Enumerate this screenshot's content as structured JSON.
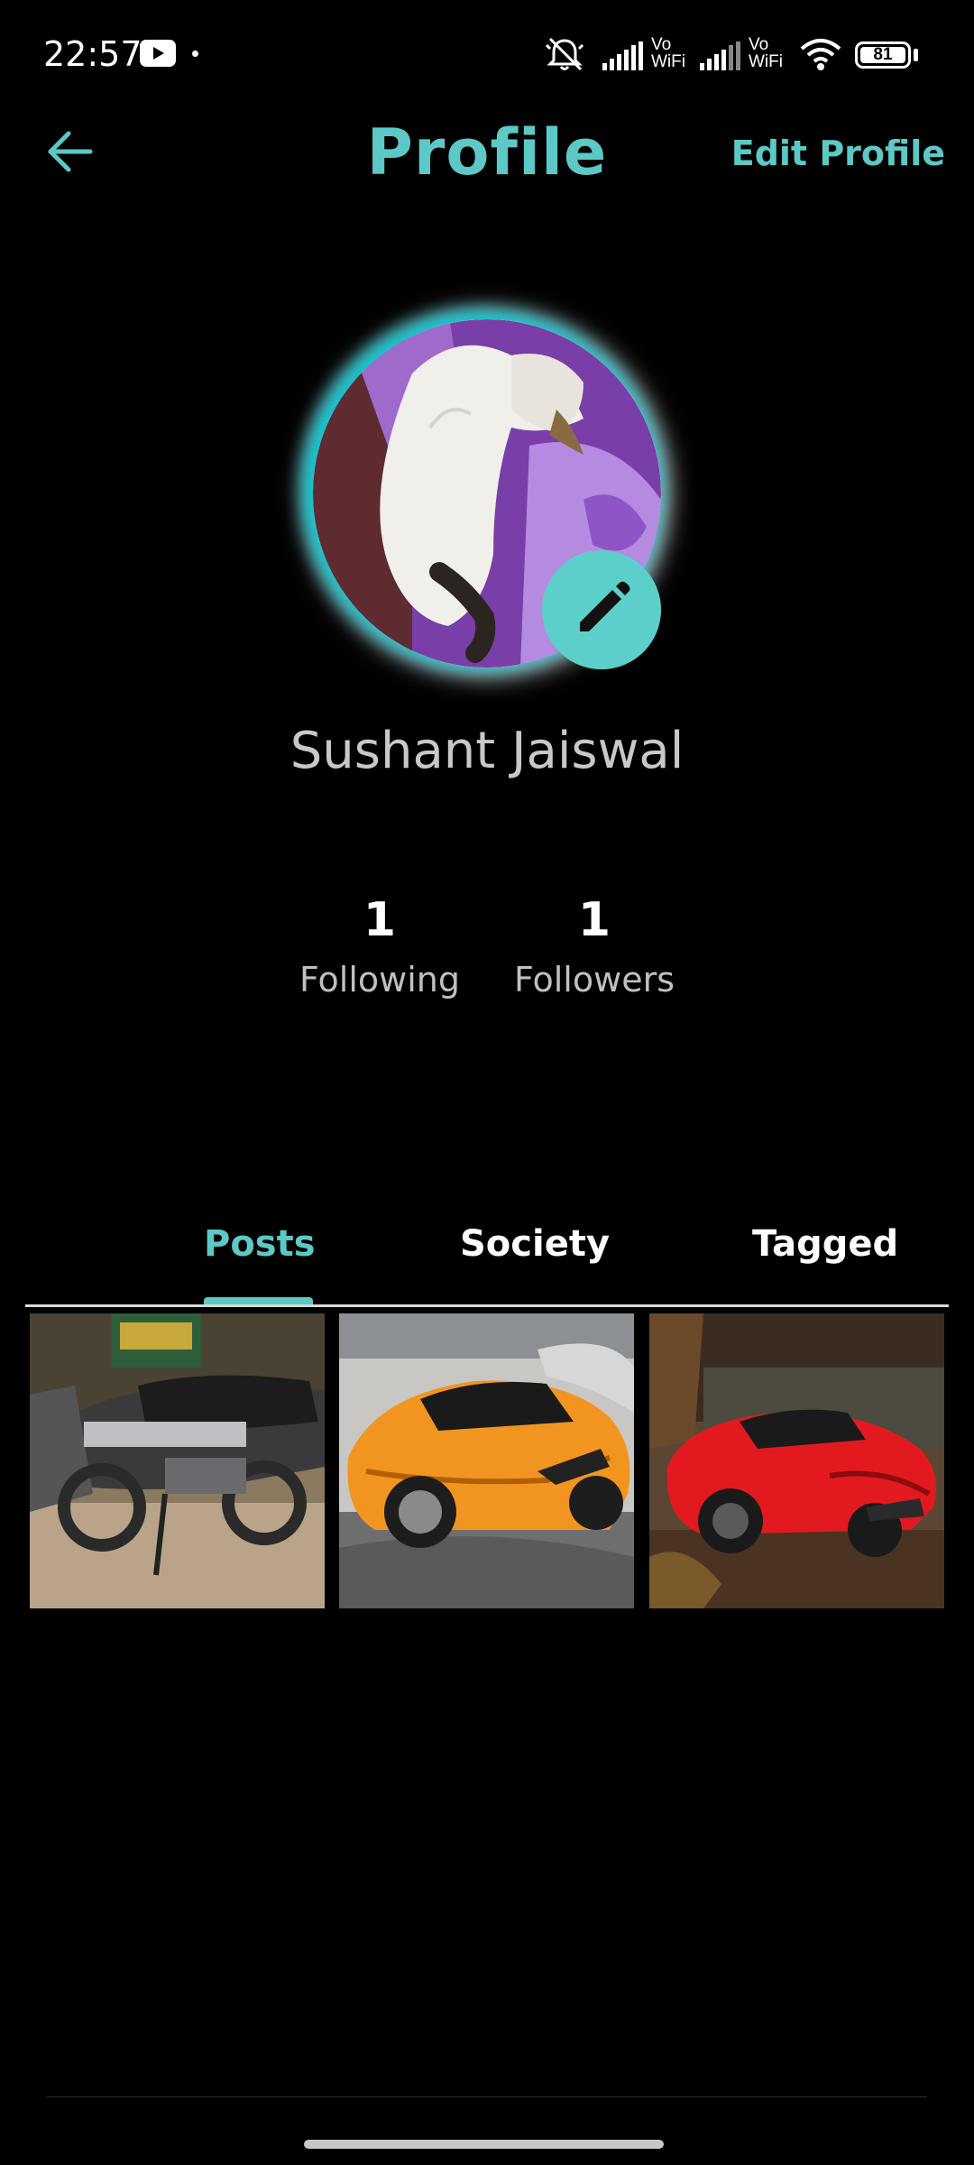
{
  "status_bar": {
    "time": "22:57",
    "wifi_label_top": "Vo",
    "wifi_label_bottom": "WiFi",
    "battery": "81"
  },
  "header": {
    "title": "Profile",
    "edit_label": "Edit Profile"
  },
  "profile": {
    "name": "Sushant Jaiswal"
  },
  "stats": [
    {
      "count": "1",
      "label": "Following"
    },
    {
      "count": "1",
      "label": "Followers"
    }
  ],
  "tabs": [
    {
      "label": "Posts",
      "active": true
    },
    {
      "label": "Society",
      "active": false
    },
    {
      "label": "Tagged",
      "active": false
    }
  ],
  "posts": [
    {
      "subject": "motorcycle-photo"
    },
    {
      "subject": "orange-sports-car-photo"
    },
    {
      "subject": "red-sports-car-photo"
    }
  ],
  "colors": {
    "accent": "#5cc9c6",
    "background": "#000000",
    "avatar_glow": "#0fc4cf"
  }
}
